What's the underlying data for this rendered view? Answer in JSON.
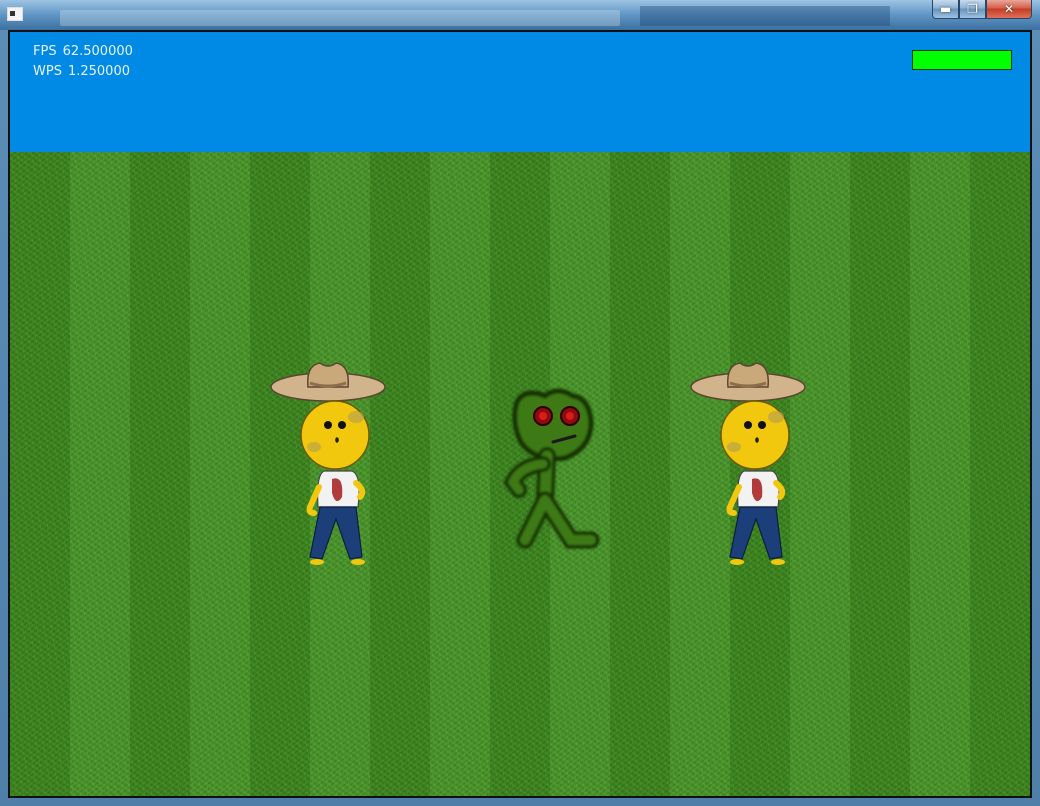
{
  "window": {
    "icons": {
      "app": "app-window-icon",
      "minimize": "minimize-icon",
      "maximize": "maximize-icon",
      "close": "close-icon"
    },
    "glyphs": {
      "minimize": "▬",
      "maximize": "❐",
      "close": "✕"
    }
  },
  "hud": {
    "fps_label": "FPS",
    "fps_value": "62.500000",
    "wps_label": "WPS",
    "wps_value": "1.250000",
    "health": {
      "fraction": 1.0,
      "color": "#00ff00"
    }
  },
  "colors": {
    "sky": "#008ae6",
    "grass": "#3f8a22",
    "health_bar": "#00ff00"
  },
  "entities": [
    {
      "type": "farmer",
      "name": "farmer-left"
    },
    {
      "type": "zombie",
      "name": "zombie-center"
    },
    {
      "type": "farmer",
      "name": "farmer-right"
    }
  ]
}
